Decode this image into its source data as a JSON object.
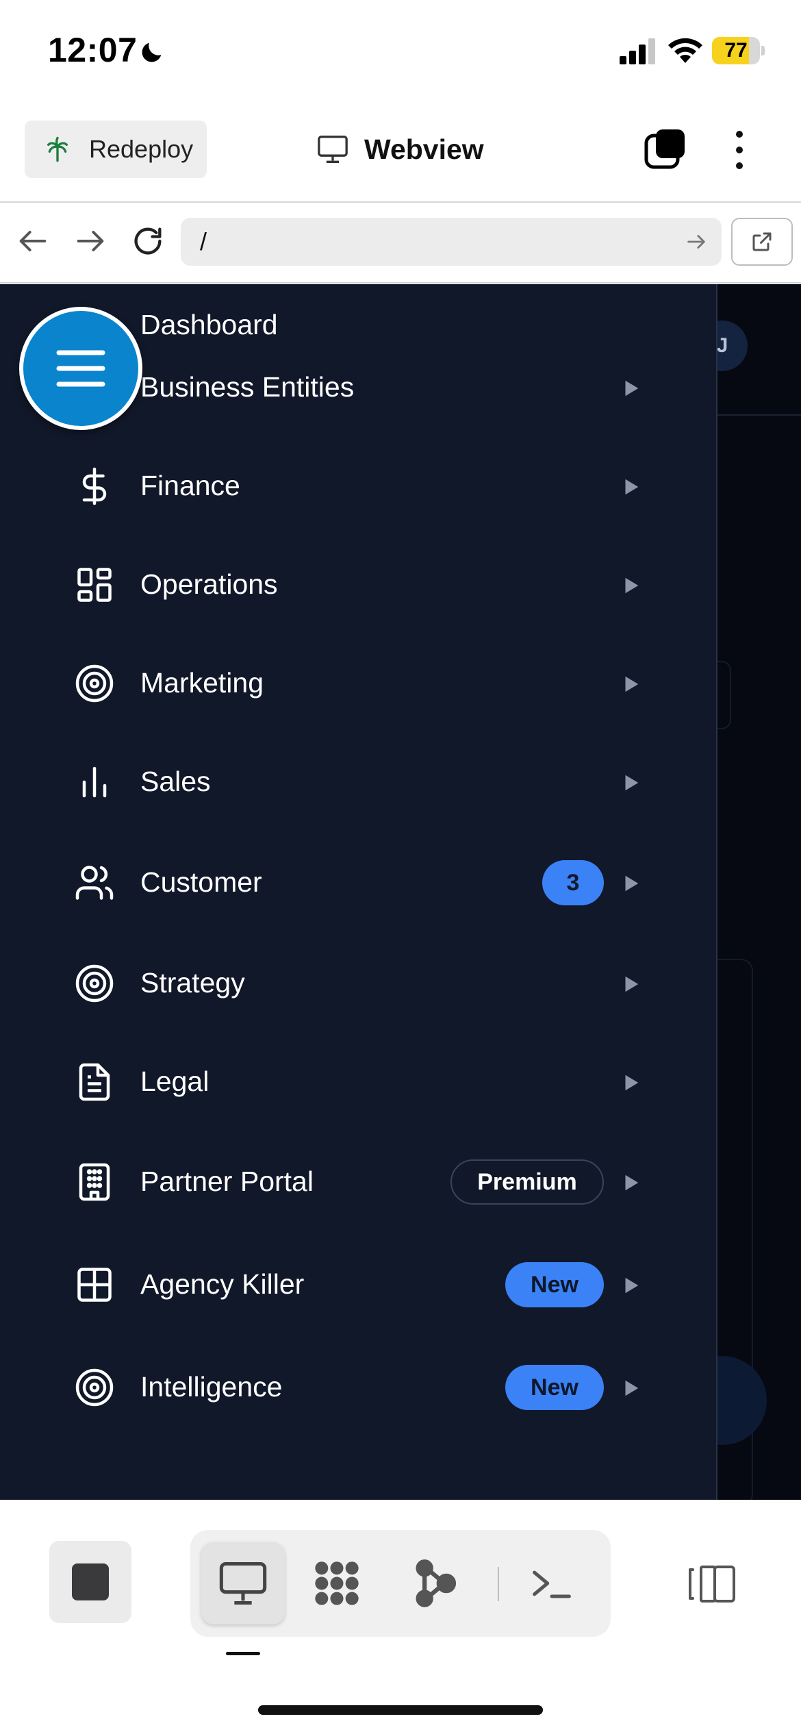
{
  "status_bar": {
    "time": "12:07",
    "battery_percent": "77",
    "battery_level": 0.77,
    "battery_color": "#f7d21c",
    "icons": [
      "moon-icon",
      "cellular-signal-icon",
      "wifi-icon",
      "battery-icon"
    ]
  },
  "app_bar": {
    "redeploy_label": "Redeploy",
    "title": "Webview",
    "icons": [
      "palm-tree-icon",
      "monitor-icon",
      "tabs-icon",
      "more-vertical-icon"
    ]
  },
  "browser": {
    "url": "/",
    "icons": [
      "back-arrow-icon",
      "forward-arrow-icon",
      "reload-icon",
      "go-arrow-icon",
      "external-link-icon"
    ]
  },
  "web_page": {
    "avatar_initial": "J",
    "drawer_bg": "#111829",
    "accent": "#3b82f6",
    "fab_color": "#0a84cc",
    "menu": [
      {
        "label": "Dashboard",
        "icon": "home-icon",
        "has_arrow": false
      },
      {
        "label": "Business Entities",
        "icon": "building-icon",
        "has_arrow": true
      },
      {
        "label": "Finance",
        "icon": "dollar-icon",
        "has_arrow": true
      },
      {
        "label": "Operations",
        "icon": "layout-grid-icon",
        "has_arrow": true
      },
      {
        "label": "Marketing",
        "icon": "target-icon",
        "has_arrow": true
      },
      {
        "label": "Sales",
        "icon": "bar-chart-icon",
        "has_arrow": true
      },
      {
        "label": "Customer",
        "icon": "users-icon",
        "badge": "3",
        "badge_type": "count",
        "has_arrow": true
      },
      {
        "label": "Strategy",
        "icon": "target-icon",
        "has_arrow": true
      },
      {
        "label": "Legal",
        "icon": "file-text-icon",
        "has_arrow": true
      },
      {
        "label": "Partner Portal",
        "icon": "building-icon",
        "badge": "Premium",
        "badge_type": "premium",
        "has_arrow": true
      },
      {
        "label": "Agency Killer",
        "icon": "grid-icon",
        "badge": "New",
        "badge_type": "new",
        "has_arrow": true
      },
      {
        "label": "Intelligence",
        "icon": "target-icon",
        "badge": "New",
        "badge_type": "new",
        "has_arrow": true
      }
    ]
  },
  "bottom_bar": {
    "icons": [
      "stop-icon",
      "monitor-icon",
      "dots-cluster-icon",
      "workflow-icon",
      "terminal-icon",
      "side-panel-icon"
    ],
    "active": "monitor-icon"
  }
}
